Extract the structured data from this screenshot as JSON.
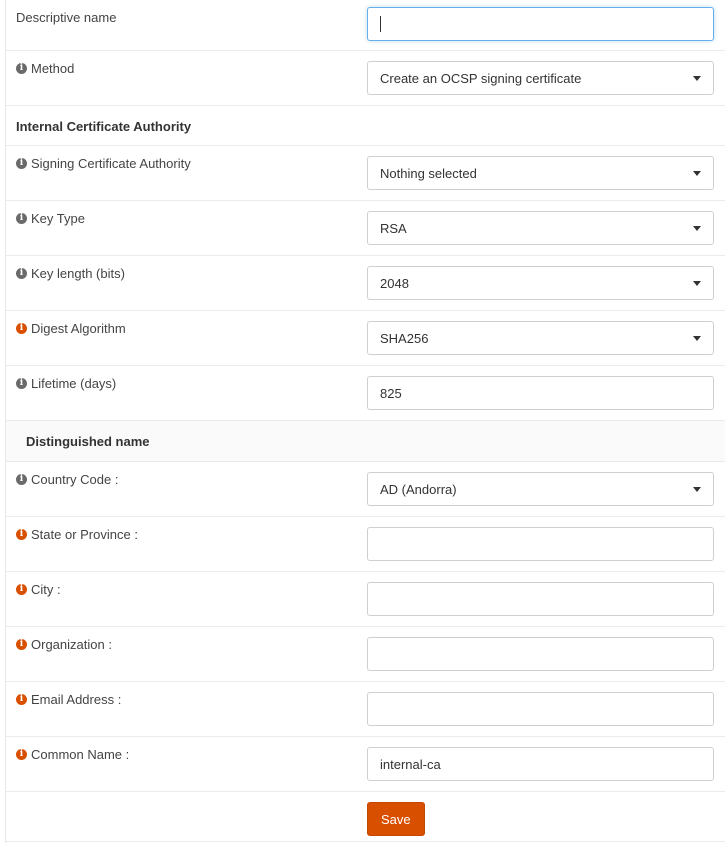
{
  "form": {
    "descriptive_name": {
      "label": "Descriptive name",
      "value": ""
    },
    "method": {
      "label": "Method",
      "value": "Create an OCSP signing certificate"
    },
    "section_internal_ca": "Internal Certificate Authority",
    "signing_ca": {
      "label": "Signing Certificate Authority",
      "value": "Nothing selected"
    },
    "key_type": {
      "label": "Key Type",
      "value": "RSA"
    },
    "key_length": {
      "label": "Key length (bits)",
      "value": "2048"
    },
    "digest_algorithm": {
      "label": "Digest Algorithm",
      "value": "SHA256"
    },
    "lifetime": {
      "label": "Lifetime (days)",
      "value": "825"
    },
    "section_distinguished_name": "Distinguished name",
    "country_code": {
      "label": "Country Code :",
      "value": "AD (Andorra)"
    },
    "state": {
      "label": "State or Province :",
      "value": ""
    },
    "city": {
      "label": "City :",
      "value": ""
    },
    "organization": {
      "label": "Organization :",
      "value": ""
    },
    "email": {
      "label": "Email Address :",
      "value": ""
    },
    "common_name": {
      "label": "Common Name :",
      "value": "internal-ca"
    },
    "save_label": "Save"
  },
  "colors": {
    "accent": "#d94f00",
    "info_icon_gray": "#6a6a6a",
    "focus_border": "#66afe9"
  },
  "icons": {
    "info": "info-icon",
    "dropdown": "chevron-down-icon"
  }
}
